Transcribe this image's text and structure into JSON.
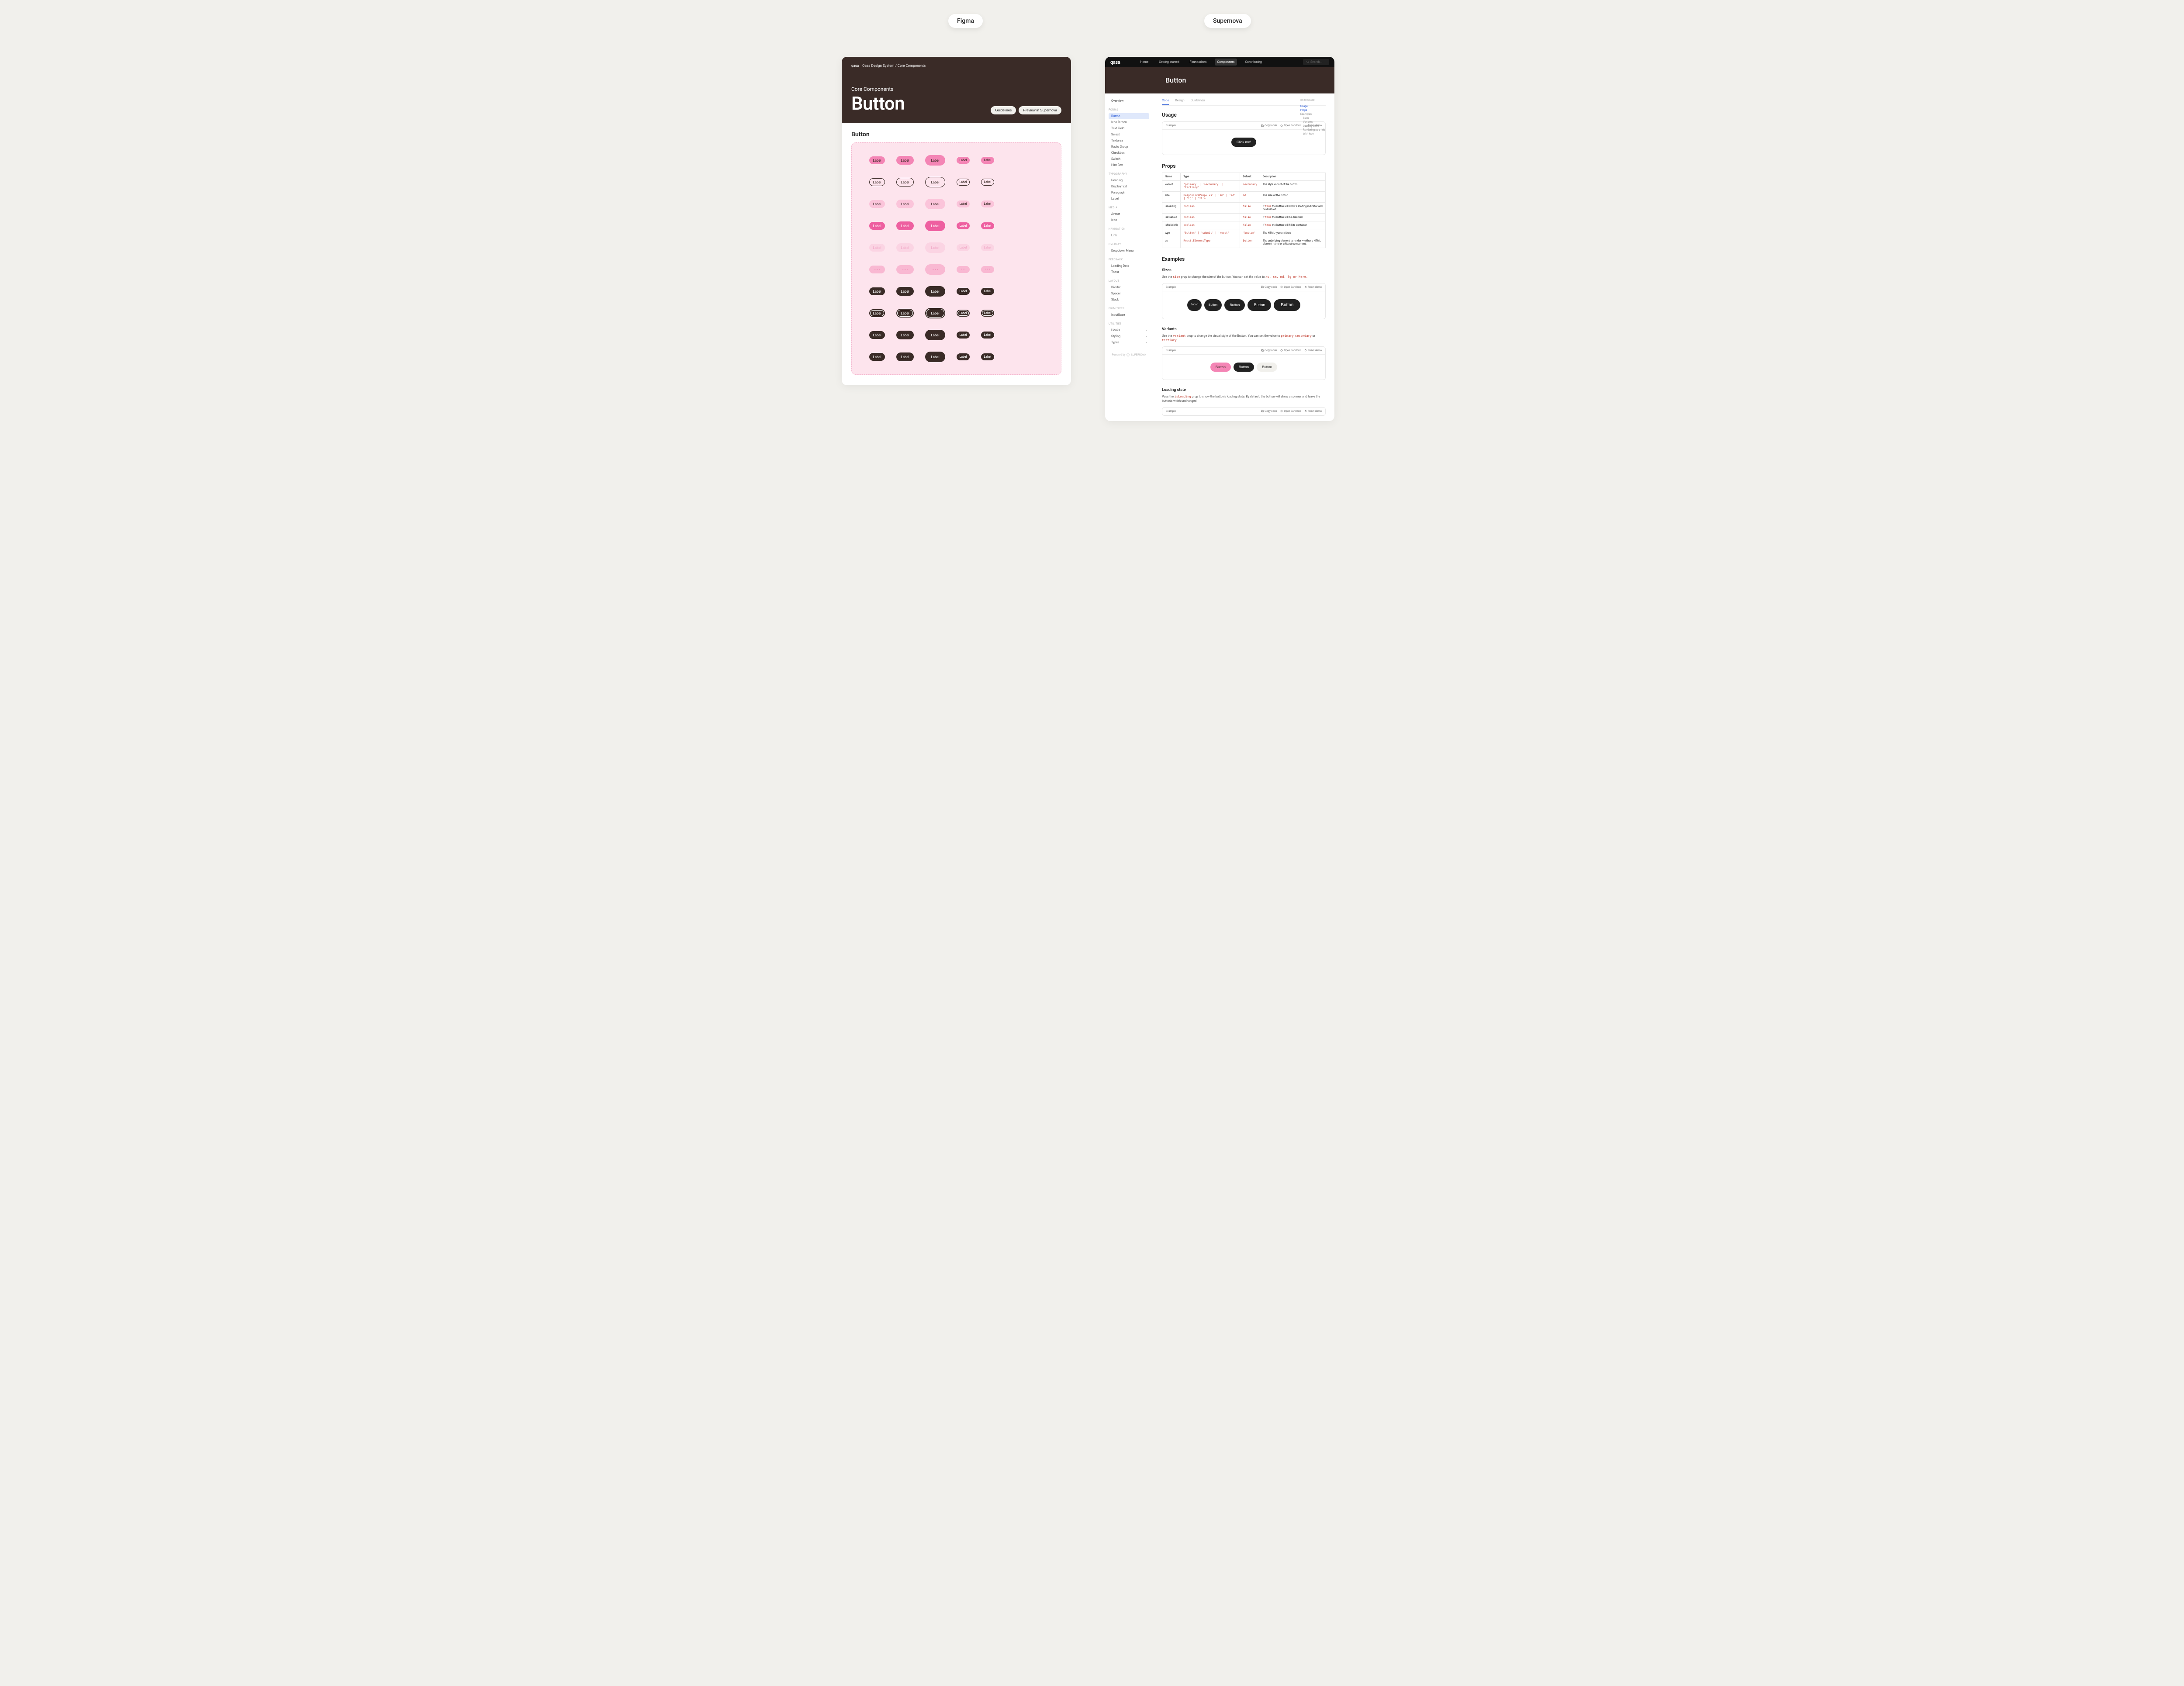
{
  "labels": {
    "figma": "Figma",
    "supernova": "Supernova"
  },
  "figma": {
    "breadcrumb": {
      "logo": "qasa",
      "root": "Qasa Design System",
      "sep": "/",
      "page": "Core Components"
    },
    "subtitle": "Core Components",
    "title": "Button",
    "actions": {
      "guidelines": "Guidelines",
      "preview": "Preview in Supernova"
    },
    "section_heading": "Button",
    "swatch_label": "Label",
    "swatch_dots": "• • •"
  },
  "sn": {
    "logo": "qasa",
    "nav": [
      "Home",
      "Getting started",
      "Foundations",
      "Components",
      "Contributing"
    ],
    "nav_active_index": 3,
    "search_placeholder": "Search...",
    "banner_title": "Button",
    "side": {
      "overview": "Overview",
      "groups": [
        {
          "h": "FORMS",
          "items": [
            "Button",
            "Icon Button",
            "Text Field",
            "Select",
            "Textarea",
            "Radio Group",
            "Checkbox",
            "Switch",
            "Hint Box"
          ],
          "active": "Button"
        },
        {
          "h": "TYPOGRAPHY",
          "items": [
            "Heading",
            "DisplayText",
            "Paragraph",
            "Label"
          ]
        },
        {
          "h": "MEDIA",
          "items": [
            "Avatar",
            "Icon"
          ]
        },
        {
          "h": "NAVIGATION",
          "items": [
            "Link"
          ]
        },
        {
          "h": "OVERLAY",
          "items": [
            "Dropdown Menu"
          ]
        },
        {
          "h": "FEEDBACK",
          "items": [
            "Loading Dots",
            "Toast"
          ]
        },
        {
          "h": "LAYOUT",
          "items": [
            "Divider",
            "Spacer",
            "Stack"
          ]
        },
        {
          "h": "PRIMITIVES",
          "items": [
            "InputBase"
          ]
        },
        {
          "h": "UTILITIES",
          "items": [
            "Hooks",
            "Styling",
            "Types"
          ],
          "chevrons": true
        }
      ],
      "powered": "Powered by",
      "powered_brand": "SUPERNOVA"
    },
    "tabs": [
      "Code",
      "Design",
      "Guidelines"
    ],
    "tabs_active": 0,
    "toc": {
      "heading": "ON THIS PAGE",
      "items": [
        "Usage",
        "Props",
        "Examples",
        "Sizes",
        "Variants",
        "Loading state",
        "Rendering as a link",
        "With icon"
      ],
      "indent_from": 3,
      "active": [
        0,
        1
      ]
    },
    "usage": {
      "heading": "Usage",
      "example": "Example",
      "actions": {
        "copy": "Copy code",
        "sandbox": "Open Sandbox",
        "reset": "Reset demo"
      },
      "button_label": "Click me!"
    },
    "props": {
      "heading": "Props",
      "cols": [
        "Name",
        "Type",
        "Default",
        "Description"
      ],
      "rows": [
        {
          "n": "variant",
          "t": "'primary' | 'secondary' | 'tertiary'",
          "d": "secondary",
          "desc": "The style variant of the button"
        },
        {
          "n": "size",
          "t": "ResponsiveProp<'xs' | 'sm' | 'md' | 'lg' | 'xl'>",
          "d": "md",
          "desc": "The size of the button"
        },
        {
          "n": "isLoading",
          "t": "boolean",
          "d": "false",
          "desc_pre": "If ",
          "desc_code": "true",
          "desc_post": " the button will show a loading indicator and be disabled"
        },
        {
          "n": "isDisabled",
          "t": "boolean",
          "d": "false",
          "desc_pre": "If ",
          "desc_code": "true",
          "desc_post": " the button will be disabled"
        },
        {
          "n": "isFullWidth",
          "t": "boolean",
          "d": "false",
          "desc_pre": "If ",
          "desc_code": "true",
          "desc_post": " the button will fill its container"
        },
        {
          "n": "type",
          "t": "'button' | 'submit' | 'reset'",
          "d": "'button'",
          "desc": "The HTML type attribute"
        },
        {
          "n": "as",
          "t": "React.ElementType",
          "d": "button",
          "desc": "The underlying element to render — either a HTML element name or a React component."
        }
      ]
    },
    "examples": {
      "heading": "Examples",
      "sizes": {
        "heading": "Sizes",
        "text_pre": "Use the ",
        "text_code": "size",
        "text_mid": " prop to change the size of the button. You can set the value to ",
        "text_values": "xs, sm, md, lg or here.",
        "btn": "Button"
      },
      "variants": {
        "heading": "Variants",
        "text_pre": "Use the ",
        "text_code": "variant",
        "text_mid": " prop to change the visual style of the Button. You can set the value to ",
        "v1": "primary",
        "comma": ", ",
        "v2": "secondary",
        "or": " or ",
        "v3": "tertiary",
        "dot": ".",
        "btn": "Button"
      },
      "loading": {
        "heading": "Loading state",
        "text_pre": "Pass the ",
        "text_code": "isLoading",
        "text_post": " prop to show the button's loading state. By default, the button will show a spinner and leave the button's width unchanged."
      }
    }
  }
}
